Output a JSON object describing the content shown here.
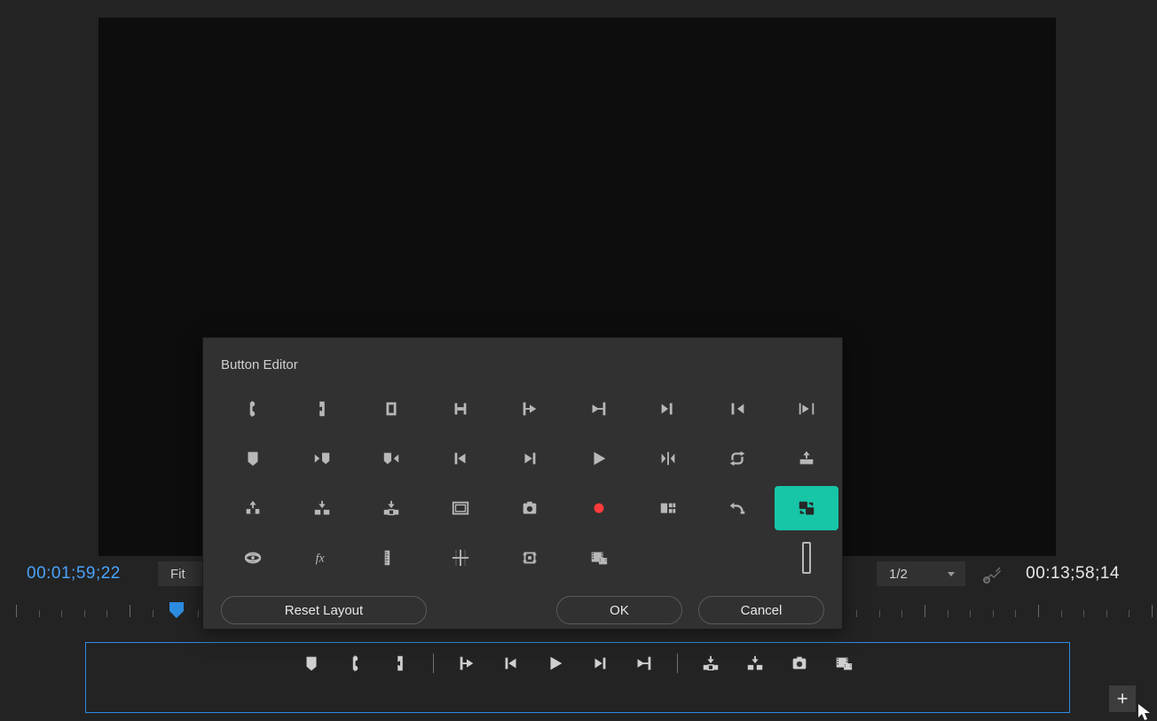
{
  "timecode": {
    "left": "00:01;59;22",
    "right": "00:13;58;14"
  },
  "zoom": {
    "fit": "Fit",
    "resolution": "1/2"
  },
  "dialog": {
    "title": "Button Editor",
    "buttons": {
      "reset": "Reset Layout",
      "ok": "OK",
      "cancel": "Cancel"
    },
    "grid": [
      [
        "mark-in",
        "mark-out",
        "mark-clip",
        "mark-selection",
        "go-to-in",
        "go-to-out",
        "go-to-next-edit",
        "go-to-prev-edit",
        "play-in-to-out"
      ],
      [
        "add-marker",
        "go-to-next-marker",
        "go-to-prev-marker",
        "step-back",
        "step-forward",
        "play",
        "play-around",
        "loop",
        "insert"
      ],
      [
        "overwrite",
        "extract",
        "lift",
        "safe-margins",
        "export-frame",
        "record",
        "multicam",
        "undo-edit",
        "comparison-view"
      ],
      [
        "vr-video",
        "fx-mute",
        "ruler",
        "guides",
        "crop",
        "proxy",
        "",
        "",
        "vbar"
      ]
    ],
    "selected": "comparison-view"
  },
  "transport": [
    "add-marker",
    "mark-in",
    "mark-out",
    "sep",
    "go-to-in",
    "step-back",
    "play",
    "step-forward",
    "go-to-out",
    "sep",
    "lift",
    "extract",
    "export-frame",
    "proxy"
  ],
  "add_button_label": "+"
}
